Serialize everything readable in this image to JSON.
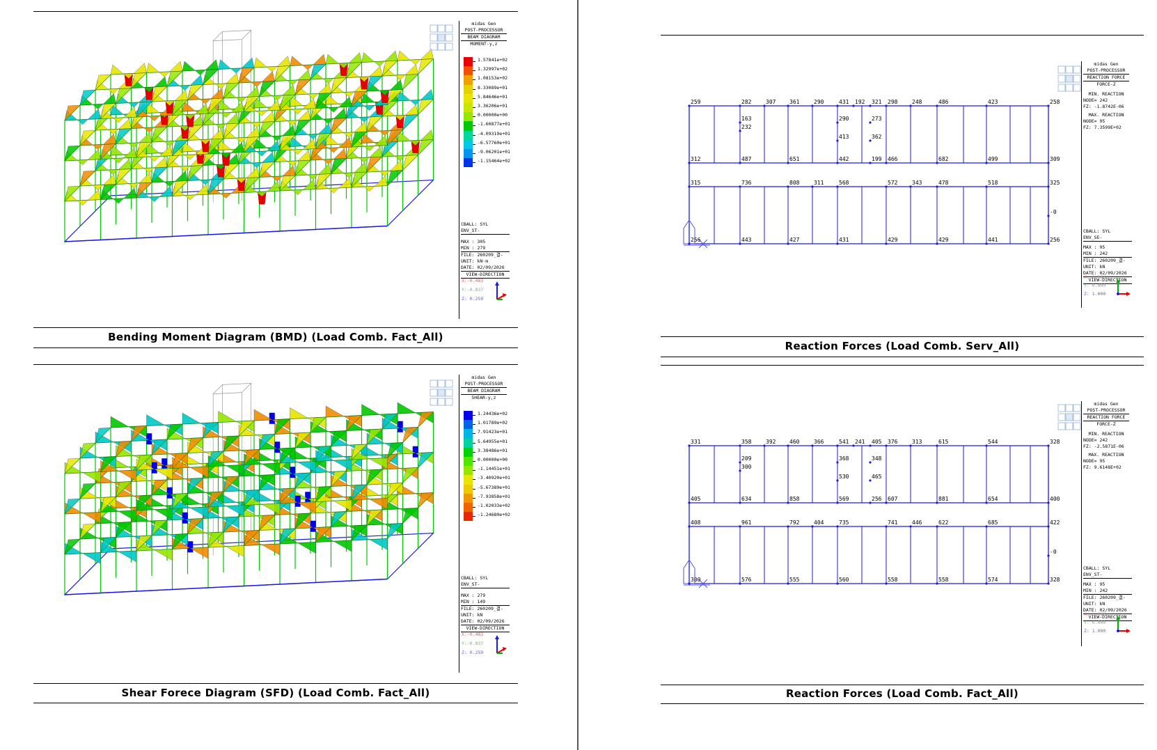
{
  "colors": {
    "frame": "#1a1ae6",
    "red": "#e60000",
    "orange": "#f08c00",
    "yellow": "#e6e600",
    "lime": "#96e600",
    "green": "#00c800",
    "cyan": "#00c8c8",
    "blue": "#0000e6"
  },
  "panels": {
    "bmd": {
      "caption": "Bending Moment Diagram (BMD) (Load Comb. Fact_All)",
      "brand": "midas Gen",
      "post": "POST-PROCESSOR",
      "type": "BEAM DIAGRAM",
      "component": "MOMENT-y,z",
      "legend": [
        "1.57841e+02",
        "1.32997e+02",
        "1.08153e+02",
        "8.33089e+01",
        "5.84646e+01",
        "3.36206e+01",
        "0.00000e+00",
        "-1.60877e+01",
        "-4.09319e+01",
        "-6.57760e+01",
        "-9.06201e+01",
        "-1.15464e+02"
      ],
      "cball": "CBALL: SYL ENV_ST-",
      "max": "MAX : 305",
      "min": "MIN : 279",
      "file": "FILE: 260209_결-",
      "unit": "UNIT: kN·m",
      "date": "DATE: 02/09/2026",
      "view": "VIEW-DIRECTION",
      "vx": "X:-0.483",
      "vy": "Y:-0.837",
      "vz": "Z: 0.259"
    },
    "sfd": {
      "caption": "Shear Forece Diagram (SFD) (Load Comb. Fact_All)",
      "brand": "midas Gen",
      "post": "POST-PROCESSOR",
      "type": "BEAM DIAGRAM",
      "component": "SHEAR-y,z",
      "legend": [
        "1.24436e+02",
        "1.01789e+02",
        "7.91423e+01",
        "5.64955e+01",
        "3.38486e+01",
        "0.00000e+00",
        "-1.14451e+01",
        "-3.40920e+01",
        "-5.67389e+01",
        "-7.93858e+01",
        "-1.02033e+02",
        "-1.24680e+02"
      ],
      "cball": "CBALL: SYL ENV_ST-",
      "max": "MAX : 279",
      "min": "MIN : 149",
      "file": "FILE: 260209_결-",
      "unit": "UNIT: kN",
      "date": "DATE: 02/09/2026",
      "view": "VIEW-DIRECTION",
      "vx": "X:-0.483",
      "vy": "Y:-0.837",
      "vz": "Z: 0.259"
    },
    "rf1": {
      "caption": "Reaction Forces (Load Comb. Serv_All)",
      "brand": "midas Gen",
      "post": "POST-PROCESSOR",
      "type": "REACTION FORCE",
      "component": "FORCE-Z",
      "minhead": "MIN. REACTION",
      "minnode": "NODE=   242",
      "minfz": "FZ:  -1.8742E-06",
      "maxhead": "MAX. REACTION",
      "maxnode": "NODE=    95",
      "maxfz": "FZ:  7.3599E+02",
      "cball": "CBALL: SYL ENV_SE-",
      "max": "MAX : 95",
      "min": "MIN : 242",
      "file": "FILE: 260209_결-",
      "unit": "UNIT: kN",
      "date": "DATE: 02/09/2026",
      "view": "VIEW-DIRECTION",
      "vx": "X: 0.000",
      "vy": "Y: 0.000",
      "vz": "Z: 1.000",
      "nodes": {
        "top": [
          "259",
          "282",
          "307",
          "361",
          "290",
          "431",
          "192",
          "321",
          "298",
          "248",
          "486",
          "423",
          "258"
        ],
        "mid1": [
          "163",
          "232",
          "290",
          "413",
          "273",
          "362"
        ],
        "row2": [
          "312",
          "487",
          "651",
          "442",
          "199",
          "466",
          "682",
          "499",
          "309"
        ],
        "row3": [
          "315",
          "736",
          "808",
          "311",
          "568",
          "572",
          "343",
          "478",
          "518",
          "325"
        ],
        "side": "-0",
        "bot": [
          "256",
          "443",
          "427",
          "431",
          "429",
          "429",
          "441",
          "256"
        ]
      }
    },
    "rf2": {
      "caption": "Reaction Forces (Load Comb. Fact_All)",
      "brand": "midas Gen",
      "post": "POST-PROCESSOR",
      "type": "REACTION FORCE",
      "component": "FORCE-Z",
      "minhead": "MIN. REACTION",
      "minnode": "NODE=   242",
      "minfz": "FZ:  -2.5871E-06",
      "maxhead": "MAX. REACTION",
      "maxnode": "NODE=    95",
      "maxfz": "FZ:  9.6148E+02",
      "cball": "CBALL: SYL ENV_ST-",
      "max": "MAX : 95",
      "min": "MIN : 242",
      "file": "FILE: 260209_결-",
      "unit": "UNIT: kN",
      "date": "DATE: 02/09/2026",
      "view": "VIEW-DIRECTION",
      "vx": "X: 0.000",
      "vy": "Y: 0.000",
      "vz": "Z: 1.000",
      "nodes": {
        "top": [
          "331",
          "358",
          "392",
          "460",
          "366",
          "541",
          "241",
          "405",
          "376",
          "313",
          "615",
          "544",
          "328"
        ],
        "mid1": [
          "209",
          "300",
          "368",
          "530",
          "348",
          "465"
        ],
        "row2": [
          "405",
          "634",
          "858",
          "569",
          "256",
          "607",
          "881",
          "654",
          "400"
        ],
        "row3": [
          "408",
          "961",
          "792",
          "404",
          "735",
          "741",
          "446",
          "622",
          "685",
          "422"
        ],
        "side": "-0",
        "bot": [
          "300",
          "576",
          "555",
          "560",
          "558",
          "558",
          "574",
          "328"
        ]
      }
    }
  }
}
